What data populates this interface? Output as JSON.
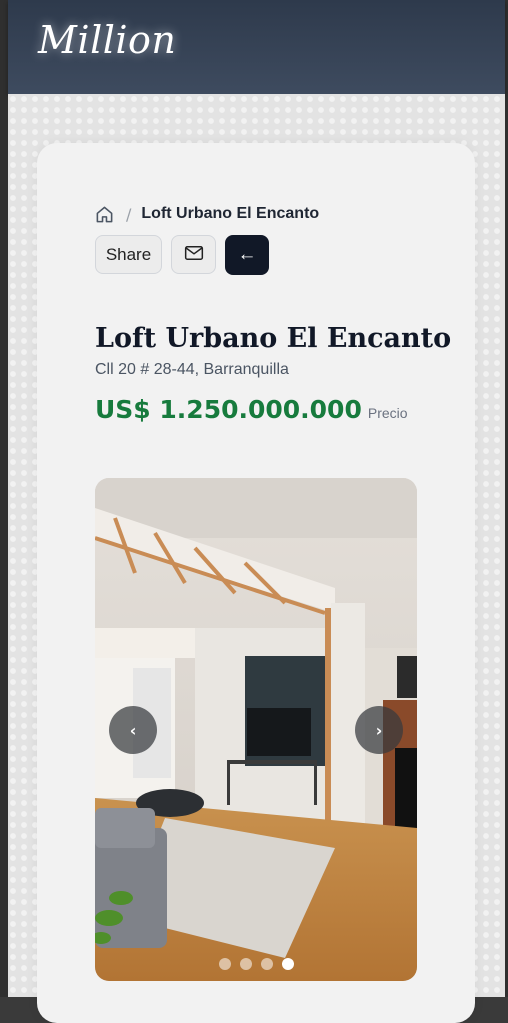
{
  "header": {
    "logo": "Million"
  },
  "breadcrumb": {
    "home_icon": "home-icon",
    "separator": "/",
    "current": "Loft Urbano El Encanto"
  },
  "actions": {
    "share_label": "Share",
    "mail_icon": "mail-icon",
    "back_label": "←"
  },
  "property": {
    "title": "Loft Urbano El Encanto",
    "address": "Cll 20 # 28-44, Barranquilla",
    "price": "US$ 1.250.000.000",
    "price_label": "Precio"
  },
  "gallery": {
    "prev_label": "‹",
    "next_label": "›",
    "slide_count": 4,
    "active_slide": 4
  },
  "colors": {
    "header_bg": "#3a4658",
    "price": "#177b3d",
    "back_button": "#111827"
  }
}
